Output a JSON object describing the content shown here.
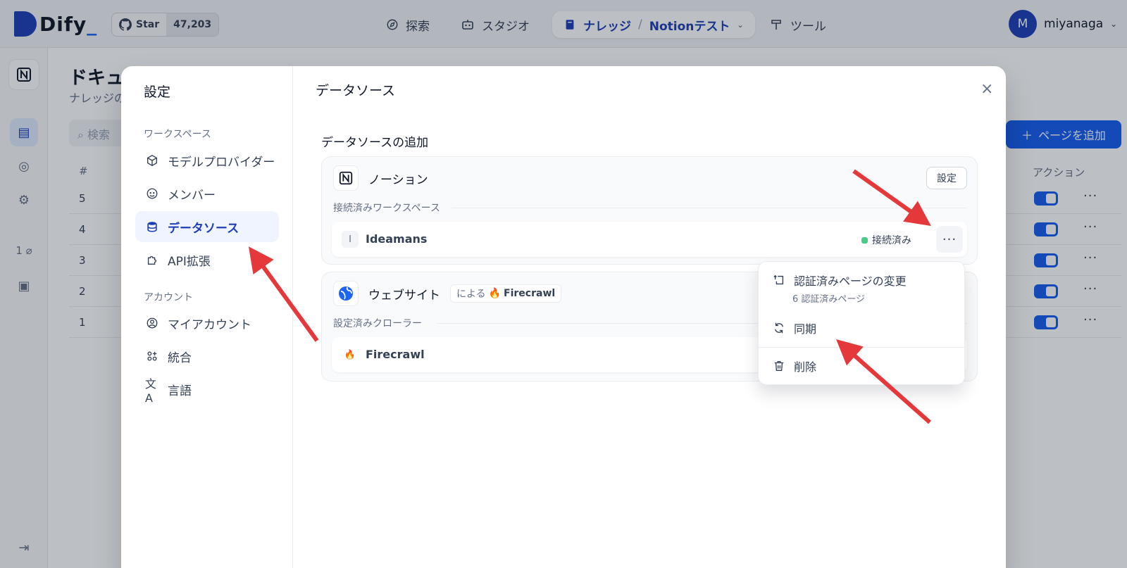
{
  "app": {
    "logo_text": "Dify",
    "github": {
      "star_label": "Star",
      "star_count": "47,203"
    },
    "nav": {
      "explore": "探索",
      "studio": "スタジオ",
      "knowledge": "ナレッジ",
      "knowledge_sep": "/",
      "dataset_name": "Notionテスト",
      "tools": "ツール"
    },
    "user": {
      "initial": "M",
      "name": "miyanaga"
    }
  },
  "background": {
    "title": "ドキュ",
    "subtitle": "ナレッジの",
    "search_placeholder": "検索",
    "add_page_button": "ページを追加",
    "col_number": "#",
    "col_action": "アクション",
    "row_numbers": [
      "5",
      "4",
      "3",
      "2",
      "1"
    ],
    "rail_count": "1"
  },
  "settings": {
    "title": "設定",
    "workspace_group": "ワークスペース",
    "account_group": "アカウント",
    "workspace_items": [
      {
        "label": "モデルプロバイダー",
        "icon": "cube-icon"
      },
      {
        "label": "メンバー",
        "icon": "members-icon"
      },
      {
        "label": "データソース",
        "icon": "database-icon",
        "active": true
      },
      {
        "label": "API拡張",
        "icon": "puzzle-icon"
      }
    ],
    "account_items": [
      {
        "label": "マイアカウント",
        "icon": "user-circle-icon"
      },
      {
        "label": "統合",
        "icon": "apps-icon"
      },
      {
        "label": "言語",
        "icon": "translate-icon"
      }
    ]
  },
  "datasource": {
    "page_title": "データソース",
    "section_title": "データソースの追加",
    "notion": {
      "name": "ノーション",
      "settings_button": "設定",
      "connected_label": "接続済みワークスペース",
      "workspace": {
        "initial": "I",
        "name": "Ideamans",
        "status": "接続済み"
      }
    },
    "website": {
      "name": "ウェブサイト",
      "by_prefix": "による",
      "provider": "Firecrawl",
      "crawler_label": "設定済みクローラー",
      "crawler_name": "Firecrawl"
    },
    "menu": {
      "change_pages": "認証済みページの変更",
      "change_pages_sub": "6 認証済みページ",
      "sync": "同期",
      "delete": "削除"
    }
  },
  "colors": {
    "accent": "#155eef",
    "brand": "#1c3fb7",
    "status_green": "#47cd89",
    "annotation_arrow": "#e5383b"
  }
}
